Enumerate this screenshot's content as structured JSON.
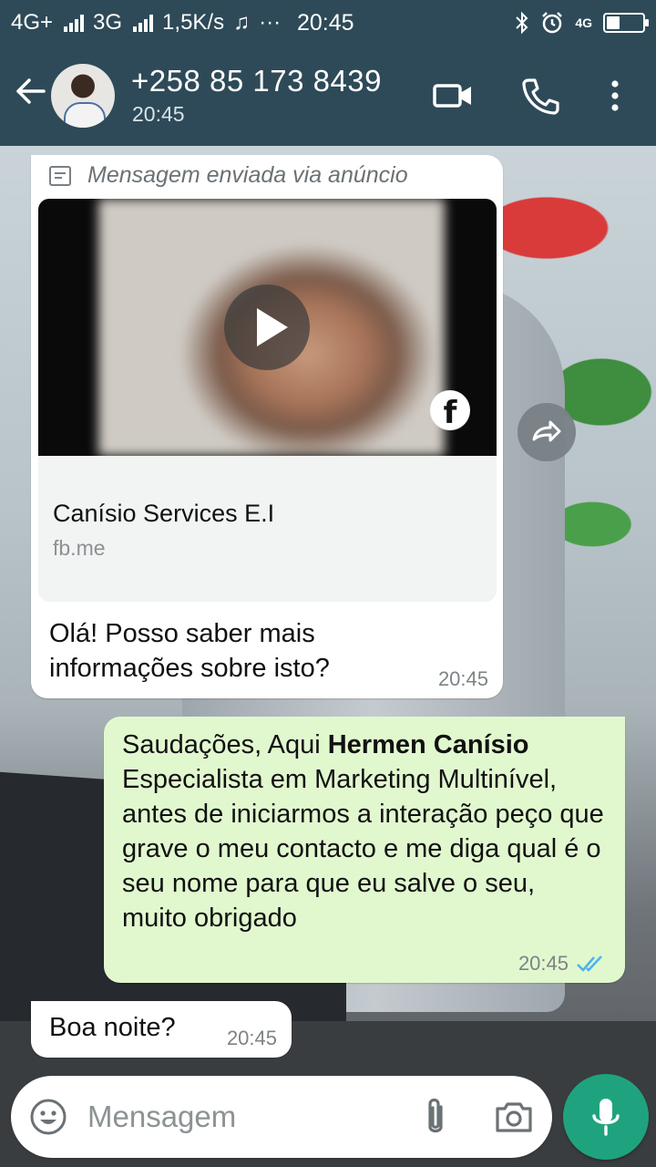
{
  "status_bar": {
    "network_1": "4G+",
    "network_2": "3G",
    "speed": "1,5K/s",
    "more": "···",
    "time": "20:45",
    "net_type": "4G"
  },
  "header": {
    "contact_name": "+258 85 173 8439",
    "subtitle": "20:45"
  },
  "messages": [
    {
      "direction": "incoming",
      "ad_label": "Mensagem enviada via anúncio",
      "ad_title": "Canísio Services E.I",
      "ad_link": "fb.me",
      "text": "Olá! Posso saber mais informações sobre isto?",
      "time": "20:45"
    },
    {
      "direction": "outgoing",
      "text_before": "Saudações, Aqui ",
      "text_bold": "Hermen Canísio",
      "text_after": " Especialista em Marketing Multinível, antes de iniciarmos a interação peço que grave o meu contacto e me diga qual é o seu nome para que eu salve o seu, muito obrigado",
      "time": "20:45",
      "status": "read"
    },
    {
      "direction": "incoming",
      "text": "Boa noite?",
      "time": "20:45"
    }
  ],
  "composer": {
    "placeholder": "Mensagem"
  },
  "colors": {
    "header_bg": "#2e4a58",
    "outgoing_bubble": "#e1f8cf",
    "incoming_bubble": "#ffffff",
    "mic_button": "#1fa37e",
    "read_ticks": "#4fb3e8"
  }
}
